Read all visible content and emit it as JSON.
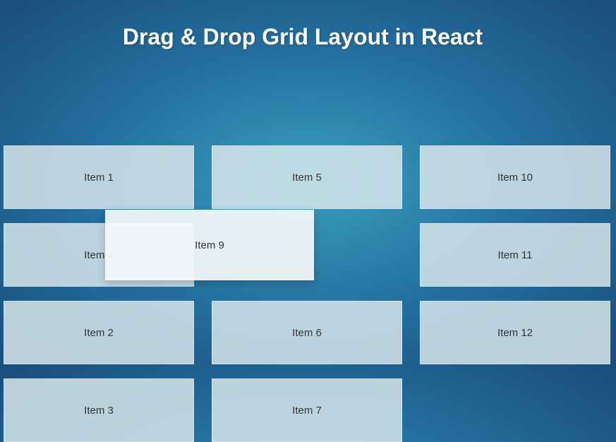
{
  "title": "Drag & Drop Grid Layout in React",
  "grid": {
    "items": [
      {
        "label": "Item 1"
      },
      {
        "label": "Item 4"
      },
      {
        "label": "Item 2"
      },
      {
        "label": "Item 3"
      },
      {
        "label": "Item 5"
      },
      {
        "label": "Item 6"
      },
      {
        "label": "Item 7"
      },
      {
        "label": "Item 10"
      },
      {
        "label": "Item 11"
      },
      {
        "label": "Item 12"
      }
    ],
    "dragging": {
      "label": "Item 9"
    }
  }
}
